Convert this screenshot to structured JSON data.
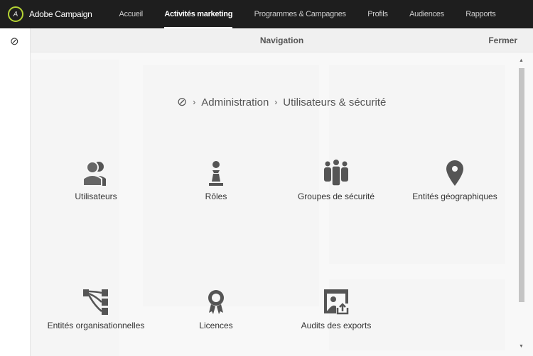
{
  "topbar": {
    "brand": "Adobe Campaign",
    "items": [
      {
        "label": "Accueil",
        "active": false
      },
      {
        "label": "Activités marketing",
        "active": true
      },
      {
        "label": "Programmes & Campagnes",
        "active": false
      },
      {
        "label": "Profils",
        "active": false
      },
      {
        "label": "Audiences",
        "active": false
      },
      {
        "label": "Rapports",
        "active": false
      }
    ],
    "accent": "#b5d334"
  },
  "panel": {
    "title": "Navigation",
    "close_label": "Fermer"
  },
  "breadcrumb": {
    "items": [
      "Administration",
      "Utilisateurs & sécurité"
    ]
  },
  "tiles": [
    {
      "label": "Utilisateurs",
      "icon": "users-icon"
    },
    {
      "label": "Rôles",
      "icon": "pawn-icon"
    },
    {
      "label": "Groupes de sécurité",
      "icon": "group-icon"
    },
    {
      "label": "Entités géographiques",
      "icon": "map-pin-icon"
    },
    {
      "label": "Entités organisationnelles",
      "icon": "org-tree-icon"
    },
    {
      "label": "Licences",
      "icon": "badge-icon"
    },
    {
      "label": "Audits des exports",
      "icon": "export-audit-icon"
    }
  ]
}
